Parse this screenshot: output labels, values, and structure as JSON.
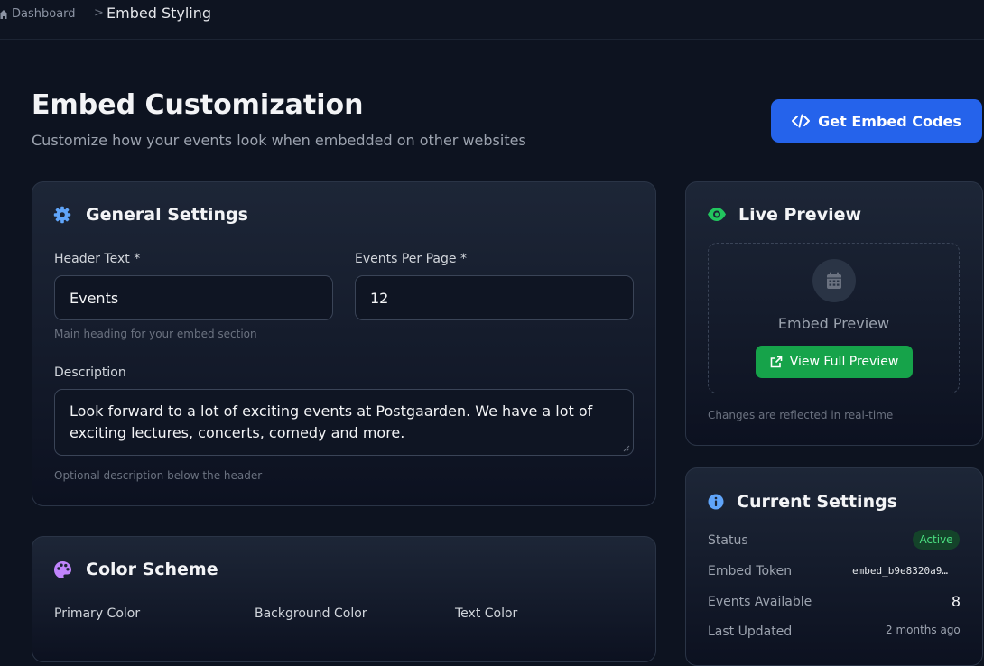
{
  "breadcrumb": {
    "home_label": "Dashboard",
    "separator": ">",
    "current": "Embed Styling"
  },
  "header": {
    "title": "Embed Customization",
    "subtitle": "Customize how your events look when embedded on other websites",
    "embed_button_label": "Get Embed Codes"
  },
  "general_settings": {
    "title": "General Settings",
    "header_text_label": "Header Text *",
    "header_text_value": "Events",
    "header_text_hint": "Main heading for your embed section",
    "events_per_page_label": "Events Per Page *",
    "events_per_page_value": "12",
    "description_label": "Description",
    "description_value": "Look forward to a lot of exciting events at Postgaarden. We have a lot of exciting lectures, concerts, comedy and more.",
    "description_hint": "Optional description below the header"
  },
  "color_scheme": {
    "title": "Color Scheme",
    "primary_label": "Primary Color",
    "background_label": "Background Color",
    "text_label": "Text Color"
  },
  "live_preview": {
    "title": "Live Preview",
    "placeholder_text": "Embed Preview",
    "view_button_label": "View Full Preview",
    "footnote": "Changes are reflected in real-time"
  },
  "current_settings": {
    "title": "Current Settings",
    "status_label": "Status",
    "status_value": "Active",
    "token_label": "Embed Token",
    "token_value": "embed_b9e8320a9…",
    "events_label": "Events Available",
    "events_value": "8",
    "updated_label": "Last Updated",
    "updated_value": "2 months ago"
  },
  "colors": {
    "accent_blue": "#2563eb",
    "success_green": "#16a34a",
    "icon_blue": "#60a5fa",
    "icon_green": "#22c55e",
    "icon_purple": "#c084fc"
  }
}
